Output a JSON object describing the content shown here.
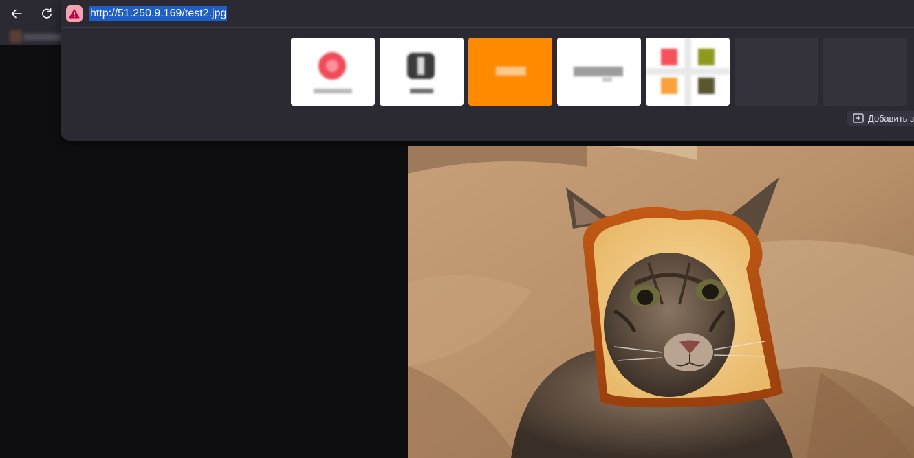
{
  "browser": {
    "url": "http://51.250.9.169/test2.jpg",
    "security_state": "not-secure-warning-icon"
  },
  "shortcuts": {
    "add_label": "Добавить з"
  },
  "colors": {
    "toolbar_bg": "#2b2a33",
    "url_highlight": "#1d5ec7",
    "warning_badge": "#f4a3b1",
    "orange_tile": "#ff8a00",
    "page_bg": "#0e0d10"
  },
  "content": {
    "image_subject": "cat-with-bread-slice"
  }
}
